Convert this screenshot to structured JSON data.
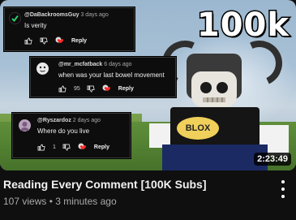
{
  "thumbnail": {
    "overlay_text": "100k",
    "duration": "2:23:49",
    "badge_text": "BLOX"
  },
  "comments": [
    {
      "author": "@DaBackroomsGuy",
      "age": "3 days ago",
      "text": "Is verity",
      "likes": "",
      "reply_label": "Reply"
    },
    {
      "author": "@mr_mcfatback",
      "age": "6 days ago",
      "text": "when was your last bowel movement",
      "likes": "95",
      "reply_label": "Reply"
    },
    {
      "author": "@Ryszardoz",
      "age": "2 days ago",
      "text": "Where do you live",
      "likes": "1",
      "reply_label": "Reply"
    }
  ],
  "video": {
    "title": "Reading Every Comment [100K Subs]",
    "meta": "107 views • 3 minutes ago"
  },
  "colors": {
    "background": "#0f0f0f",
    "card": "#0d0d0d",
    "heart": "#ff2b2b"
  }
}
